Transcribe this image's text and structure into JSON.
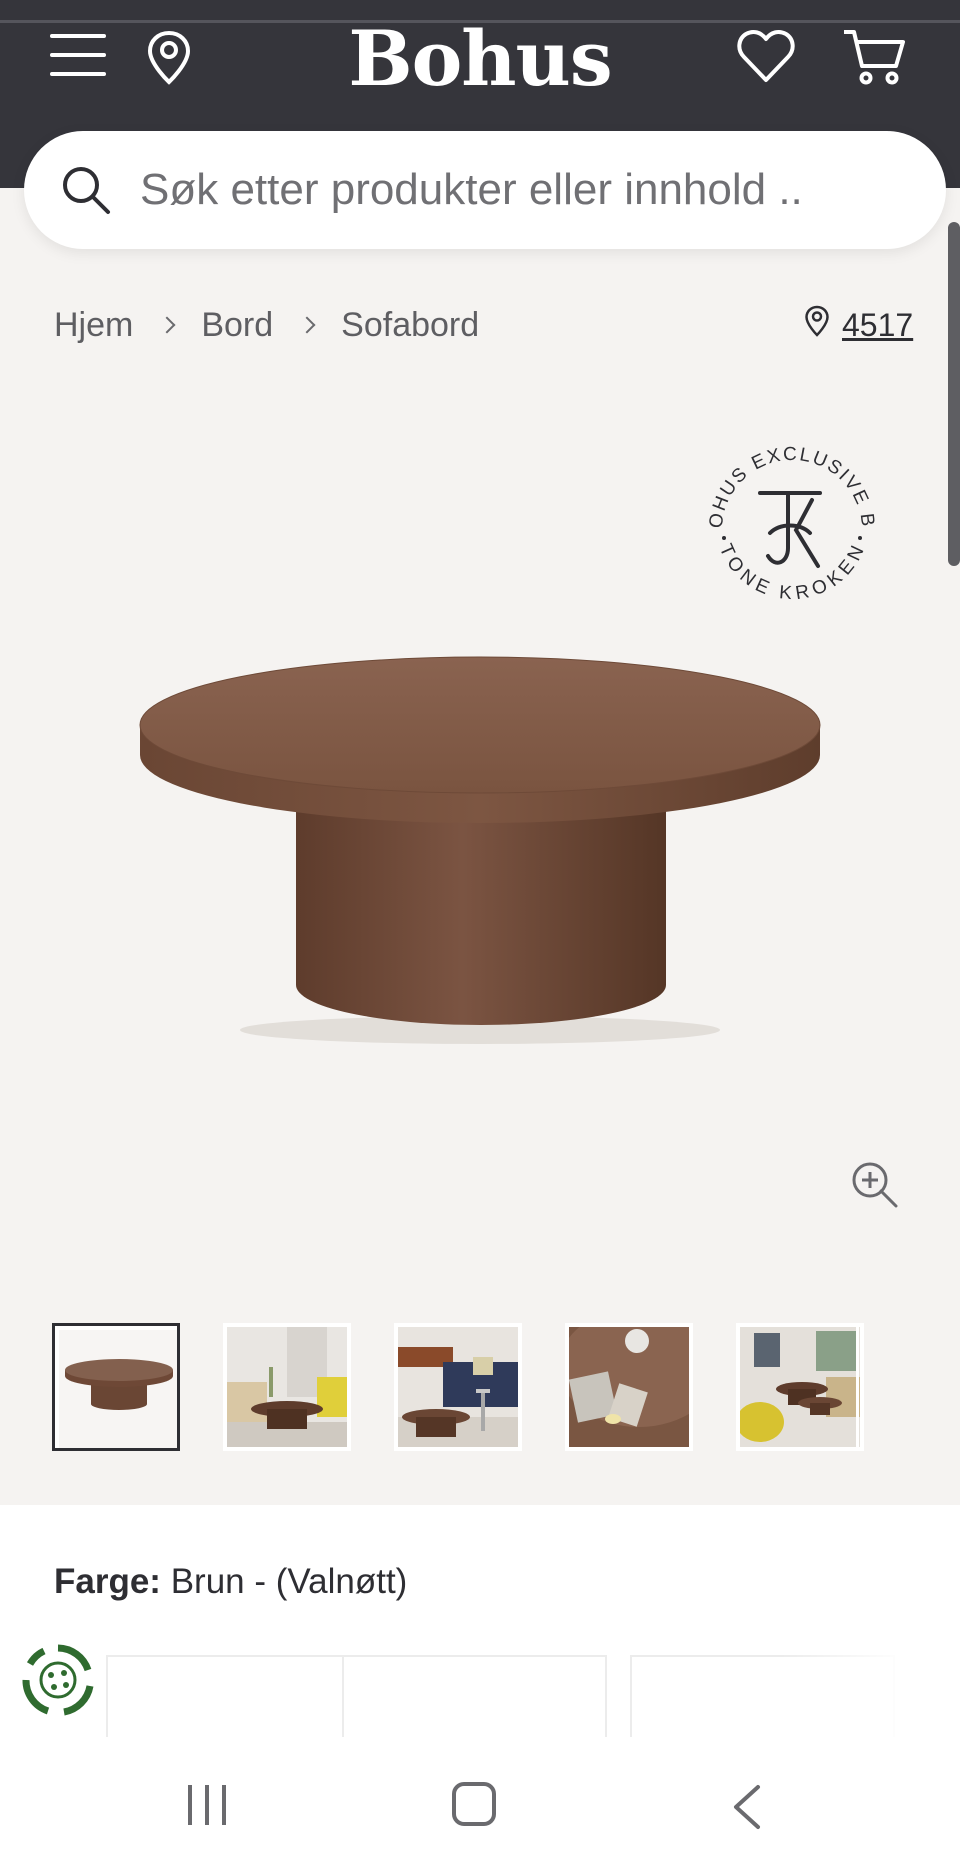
{
  "header": {
    "logo": "Bohus",
    "background": "#35353b",
    "icons": [
      "menu-icon",
      "location-pin-icon",
      "heart-icon",
      "cart-icon"
    ]
  },
  "search": {
    "placeholder": "Søk etter produkter eller innhold .."
  },
  "breadcrumb": {
    "items": [
      "Hjem",
      "Bord",
      "Sofabord"
    ]
  },
  "store": {
    "number": "4517"
  },
  "badge": {
    "top_text": "BOHUS EXCLUSIVE BY",
    "bottom_text": "TONE KROKEN",
    "monogram": "TK"
  },
  "product": {
    "color_label": "Farge:",
    "color_value": "Brun - (Valnøtt)",
    "thumbnails_count": 5
  },
  "colors": {
    "walnut": "#7a5440",
    "oak": "#c9b49a",
    "grey": "#5a5a5a",
    "eco_green": "#2f6b2f"
  }
}
